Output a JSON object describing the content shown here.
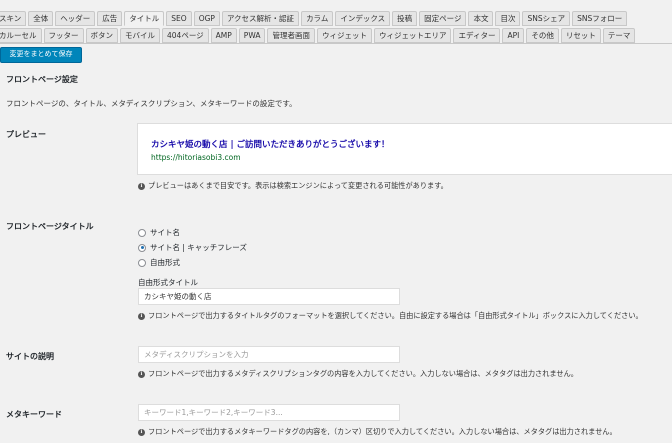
{
  "tabs_row1": [
    "スキン",
    "全体",
    "ヘッダー",
    "広告",
    "タイトル",
    "SEO",
    "OGP",
    "アクセス解析・認証",
    "カラム",
    "インデックス",
    "投稿",
    "固定ページ",
    "本文",
    "目次",
    "SNSシェア",
    "SNSフォロー"
  ],
  "tabs_row2": [
    "カルーセル",
    "フッター",
    "ボタン",
    "モバイル",
    "404ページ",
    "AMP",
    "PWA",
    "管理者画面",
    "ウィジェット",
    "ウィジェットエリア",
    "エディター",
    "API",
    "その他",
    "リセット",
    "テーマ"
  ],
  "active_tab": "タイトル",
  "save_button": "変更をまとめて保存",
  "section": {
    "title": "フロントページ設定",
    "description": "フロントページの、タイトル、メタディスクリプション、メタキーワードの設定です。"
  },
  "preview": {
    "label": "プレビュー",
    "title": "カシキヤ姫の動く店 | ご訪問いただきありがとうございます！",
    "url": "https://hitoriasobi3.com",
    "note": "プレビューはあくまで目安です。表示は検索エンジンによって変更される可能性があります。"
  },
  "front_title": {
    "label": "フロントページタイトル",
    "options": [
      "サイト名",
      "サイト名 | キャッチフレーズ",
      "自由形式"
    ],
    "selected": 1,
    "free_label": "自由形式タイトル",
    "free_value": "カシキヤ姫の動く店",
    "note": "フロントページで出力するタイトルタグのフォーマットを選択してください。自由に設定する場合は「自由形式タイトル」ボックスに入力してください。"
  },
  "site_description": {
    "label": "サイトの説明",
    "placeholder": "メタディスクリプションを入力",
    "note": "フロントページで出力するメタディスクリプションタグの内容を入力してください。入力しない場合は、メタタグは出力されません。"
  },
  "meta_keywords": {
    "label": "メタキーワード",
    "placeholder": "キーワード1,キーワード2,キーワード3...",
    "note": "フロントページで出力するメタキーワードタグの内容を,（カンマ）区切りで入力してください。入力しない場合は、メタタグは出力されません。"
  }
}
